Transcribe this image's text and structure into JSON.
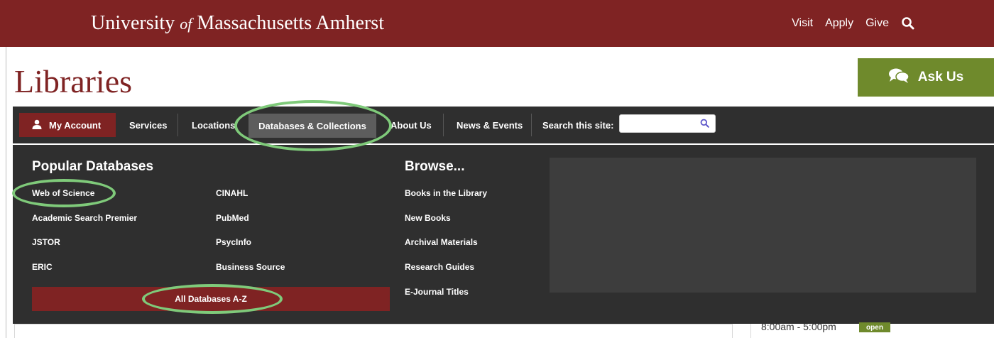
{
  "header": {
    "university_pre": "University ",
    "university_of": "of",
    "university_post": " Massachusetts Amherst",
    "links": [
      "Visit",
      "Apply",
      "Give"
    ]
  },
  "site": {
    "title": "Libraries",
    "ask_us": "Ask Us"
  },
  "nav": {
    "my_account": "My Account",
    "items": [
      "Services",
      "Locations",
      "Databases & Collections",
      "About Us",
      "News & Events"
    ],
    "search_label": "Search this site:",
    "search_value": ""
  },
  "dropdown": {
    "popular_heading": "Popular Databases",
    "popular_col1": [
      "Web of Science",
      "Academic Search Premier",
      "JSTOR",
      "ERIC"
    ],
    "popular_col2": [
      "CINAHL",
      "PubMed",
      "PsycInfo",
      "Business Source"
    ],
    "all_databases": "All Databases A-Z",
    "browse_heading": "Browse...",
    "browse_items": [
      "Books in the Library",
      "New Books",
      "Archival Materials",
      "Research Guides",
      "E-Journal Titles"
    ]
  },
  "below": {
    "hours": "8:00am - 5:00pm",
    "status": "open"
  },
  "colors": {
    "maroon": "#7f2323",
    "olive": "#6f8a2c",
    "nav_dark": "#2f2f2f",
    "highlight_ring": "#7fca7a"
  }
}
